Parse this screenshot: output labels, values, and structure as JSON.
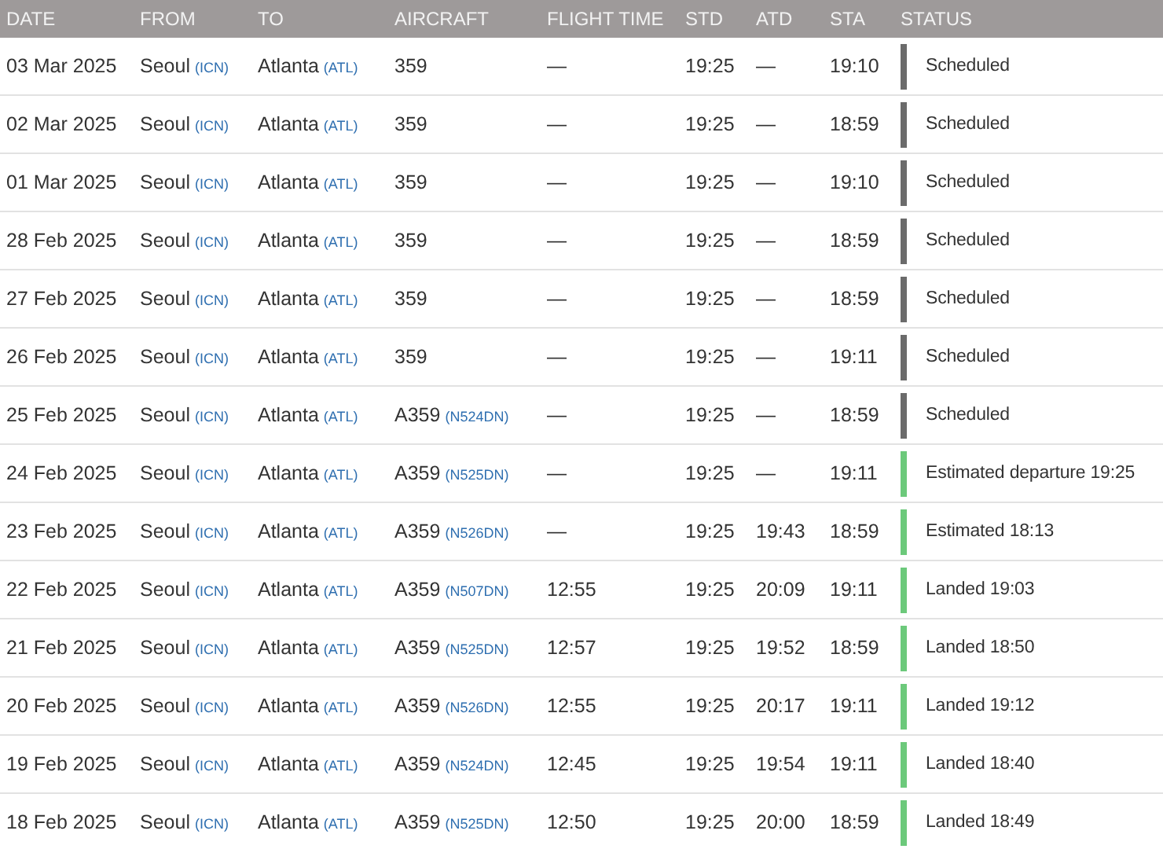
{
  "table": {
    "columns": [
      "DATE",
      "FROM",
      "TO",
      "AIRCRAFT",
      "FLIGHT TIME",
      "STD",
      "ATD",
      "STA",
      "STATUS"
    ],
    "rows": [
      {
        "date": "03 Mar 2025",
        "from": {
          "city": "Seoul",
          "code": "(ICN)"
        },
        "to": {
          "city": "Atlanta",
          "code": "(ATL)"
        },
        "aircraft": {
          "type": "359"
        },
        "flight_time": "—",
        "std": "19:25",
        "atd": "—",
        "sta": "19:10",
        "color": "#6b6b6b",
        "status": "Scheduled"
      },
      {
        "date": "02 Mar 2025",
        "from": {
          "city": "Seoul",
          "code": "(ICN)"
        },
        "to": {
          "city": "Atlanta",
          "code": "(ATL)"
        },
        "aircraft": {
          "type": "359"
        },
        "flight_time": "—",
        "std": "19:25",
        "atd": "—",
        "sta": "18:59",
        "color": "#6b6b6b",
        "status": "Scheduled"
      },
      {
        "date": "01 Mar 2025",
        "from": {
          "city": "Seoul",
          "code": "(ICN)"
        },
        "to": {
          "city": "Atlanta",
          "code": "(ATL)"
        },
        "aircraft": {
          "type": "359"
        },
        "flight_time": "—",
        "std": "19:25",
        "atd": "—",
        "sta": "19:10",
        "color": "#6b6b6b",
        "status": "Scheduled"
      },
      {
        "date": "28 Feb 2025",
        "from": {
          "city": "Seoul",
          "code": "(ICN)"
        },
        "to": {
          "city": "Atlanta",
          "code": "(ATL)"
        },
        "aircraft": {
          "type": "359"
        },
        "flight_time": "—",
        "std": "19:25",
        "atd": "—",
        "sta": "18:59",
        "color": "#6b6b6b",
        "status": "Scheduled"
      },
      {
        "date": "27 Feb 2025",
        "from": {
          "city": "Seoul",
          "code": "(ICN)"
        },
        "to": {
          "city": "Atlanta",
          "code": "(ATL)"
        },
        "aircraft": {
          "type": "359"
        },
        "flight_time": "—",
        "std": "19:25",
        "atd": "—",
        "sta": "18:59",
        "color": "#6b6b6b",
        "status": "Scheduled"
      },
      {
        "date": "26 Feb 2025",
        "from": {
          "city": "Seoul",
          "code": "(ICN)"
        },
        "to": {
          "city": "Atlanta",
          "code": "(ATL)"
        },
        "aircraft": {
          "type": "359"
        },
        "flight_time": "—",
        "std": "19:25",
        "atd": "—",
        "sta": "19:11",
        "color": "#6b6b6b",
        "status": "Scheduled"
      },
      {
        "date": "25 Feb 2025",
        "from": {
          "city": "Seoul",
          "code": "(ICN)"
        },
        "to": {
          "city": "Atlanta",
          "code": "(ATL)"
        },
        "aircraft": {
          "type": "A359",
          "reg": "(N524DN)"
        },
        "flight_time": "—",
        "std": "19:25",
        "atd": "—",
        "sta": "18:59",
        "color": "#6b6b6b",
        "status": "Scheduled"
      },
      {
        "date": "24 Feb 2025",
        "from": {
          "city": "Seoul",
          "code": "(ICN)"
        },
        "to": {
          "city": "Atlanta",
          "code": "(ATL)"
        },
        "aircraft": {
          "type": "A359",
          "reg": "(N525DN)"
        },
        "flight_time": "—",
        "std": "19:25",
        "atd": "—",
        "sta": "19:11",
        "color": "#6cc97b",
        "status": "Estimated departure 19:25"
      },
      {
        "date": "23 Feb 2025",
        "from": {
          "city": "Seoul",
          "code": "(ICN)"
        },
        "to": {
          "city": "Atlanta",
          "code": "(ATL)"
        },
        "aircraft": {
          "type": "A359",
          "reg": "(N526DN)"
        },
        "flight_time": "—",
        "std": "19:25",
        "atd": "19:43",
        "sta": "18:59",
        "color": "#6cc97b",
        "status": "Estimated 18:13"
      },
      {
        "date": "22 Feb 2025",
        "from": {
          "city": "Seoul",
          "code": "(ICN)"
        },
        "to": {
          "city": "Atlanta",
          "code": "(ATL)"
        },
        "aircraft": {
          "type": "A359",
          "reg": "(N507DN)"
        },
        "flight_time": "12:55",
        "std": "19:25",
        "atd": "20:09",
        "sta": "19:11",
        "color": "#6cc97b",
        "status": "Landed 19:03"
      },
      {
        "date": "21 Feb 2025",
        "from": {
          "city": "Seoul",
          "code": "(ICN)"
        },
        "to": {
          "city": "Atlanta",
          "code": "(ATL)"
        },
        "aircraft": {
          "type": "A359",
          "reg": "(N525DN)"
        },
        "flight_time": "12:57",
        "std": "19:25",
        "atd": "19:52",
        "sta": "18:59",
        "color": "#6cc97b",
        "status": "Landed 18:50"
      },
      {
        "date": "20 Feb 2025",
        "from": {
          "city": "Seoul",
          "code": "(ICN)"
        },
        "to": {
          "city": "Atlanta",
          "code": "(ATL)"
        },
        "aircraft": {
          "type": "A359",
          "reg": "(N526DN)"
        },
        "flight_time": "12:55",
        "std": "19:25",
        "atd": "20:17",
        "sta": "19:11",
        "color": "#6cc97b",
        "status": "Landed 19:12"
      },
      {
        "date": "19 Feb 2025",
        "from": {
          "city": "Seoul",
          "code": "(ICN)"
        },
        "to": {
          "city": "Atlanta",
          "code": "(ATL)"
        },
        "aircraft": {
          "type": "A359",
          "reg": "(N524DN)"
        },
        "flight_time": "12:45",
        "std": "19:25",
        "atd": "19:54",
        "sta": "19:11",
        "color": "#6cc97b",
        "status": "Landed 18:40"
      },
      {
        "date": "18 Feb 2025",
        "from": {
          "city": "Seoul",
          "code": "(ICN)"
        },
        "to": {
          "city": "Atlanta",
          "code": "(ATL)"
        },
        "aircraft": {
          "type": "A359",
          "reg": "(N525DN)"
        },
        "flight_time": "12:50",
        "std": "19:25",
        "atd": "20:00",
        "sta": "18:59",
        "color": "#6cc97b",
        "status": "Landed 18:49"
      }
    ]
  }
}
